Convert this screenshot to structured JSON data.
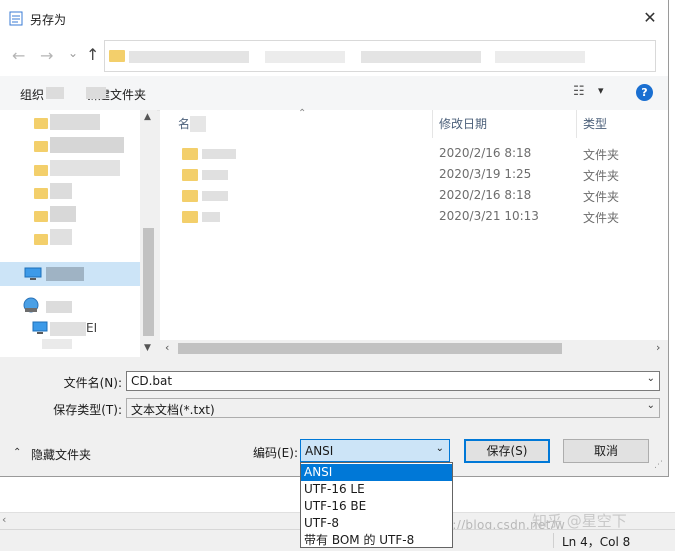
{
  "dialog": {
    "title": "另存为",
    "close_glyph": "✕"
  },
  "nav": {
    "back_glyph": "←",
    "forward_glyph": "→",
    "recent_glyph": "⌄",
    "up_glyph": "↑"
  },
  "toolbar": {
    "organize_label": "组织",
    "new_folder_label": "新建文件夹",
    "view_glyph": "☷",
    "view_arrow": "▾",
    "help_glyph": "?"
  },
  "navpane": {
    "computer_suffix": "EI"
  },
  "filelist": {
    "columns": {
      "name": "名称",
      "modified": "修改日期",
      "type": "类型"
    },
    "rows": [
      {
        "date": "2020/2/16 8:18",
        "type": "文件夹"
      },
      {
        "date": "2020/3/19 1:25",
        "type": "文件夹"
      },
      {
        "date": "2020/2/16 8:18",
        "type": "文件夹"
      },
      {
        "date": "2020/3/21 10:13",
        "type": "文件夹"
      }
    ]
  },
  "form": {
    "filename_label": "文件名(N):",
    "filename_value": "CD.bat",
    "filetype_label": "保存类型(T):",
    "filetype_value": "文本文档(*.txt)",
    "hide_folders_label": "隐藏文件夹",
    "encoding_label": "编码(E):",
    "encoding_value": "ANSI",
    "save_label": "保存(S)",
    "cancel_label": "取消"
  },
  "encoding_options": [
    "ANSI",
    "UTF-16 LE",
    "UTF-16 BE",
    "UTF-8",
    "带有 BOM 的 UTF-8"
  ],
  "background": {
    "watermark": "https://blog.csdn.net/w",
    "zhihu_mark": "知乎 @星空下",
    "cursor_position": "Ln 4，Col 8"
  },
  "colors": {
    "accent": "#0078d7",
    "selection": "#cce4f7",
    "folder": "#f3cf6b"
  }
}
